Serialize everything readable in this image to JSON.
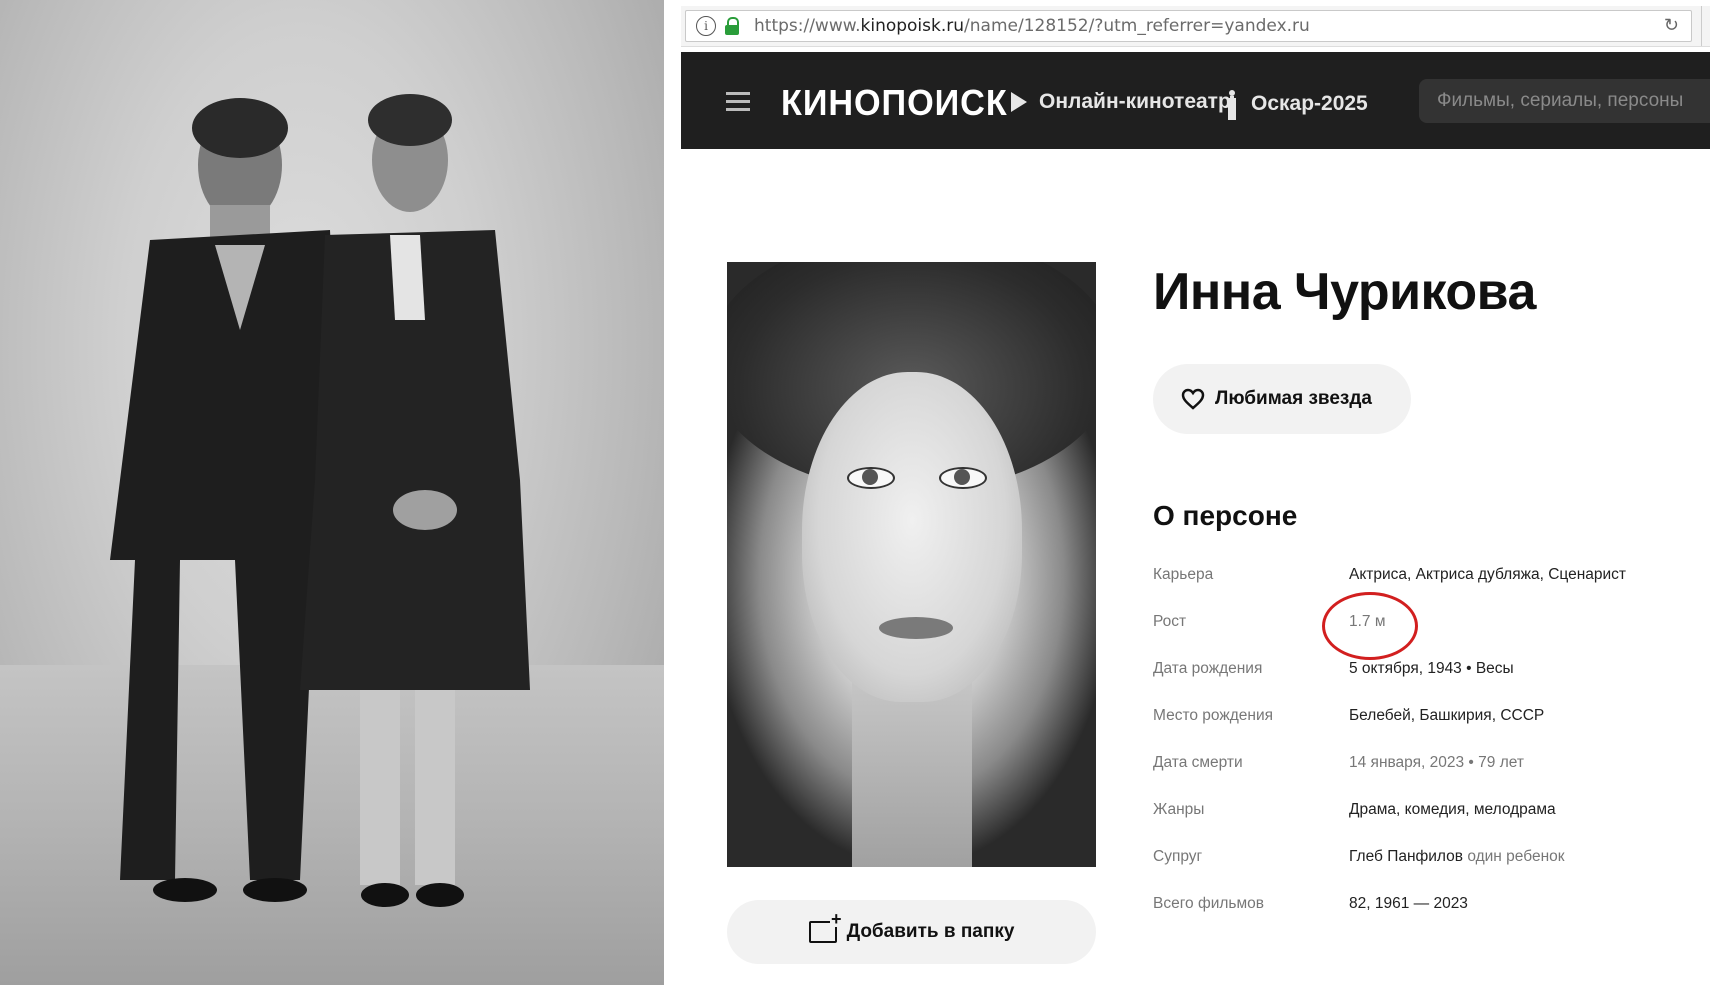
{
  "browser": {
    "url_prefix": "https://www.",
    "url_domain": "kinopoisk.ru",
    "url_rest": "/name/128152/?utm_referrer=yandex.ru"
  },
  "header": {
    "logo": "КИНОПОИСК",
    "nav_online": "Онлайн-кинотеатр",
    "nav_oscar": "Оскар-2025",
    "search_placeholder": "Фильмы, сериалы, персоны"
  },
  "person": {
    "name": "Инна Чурикова",
    "favorite_label": "Любимая звезда",
    "add_folder_label": "Добавить в папку",
    "about_title": "О персоне",
    "facts": [
      {
        "key": "Карьера",
        "value": "Актриса, Актриса дубляжа, Сценарист"
      },
      {
        "key": "Рост",
        "value": "1.7 м"
      },
      {
        "key": "Дата рождения",
        "value": "5 октября, 1943 • Весы"
      },
      {
        "key": "Место рождения",
        "value": "Белебей, Башкирия, СССР"
      },
      {
        "key": "Дата смерти",
        "value": "14 января, 2023 • 79 лет"
      },
      {
        "key": "Жанры",
        "value": "Драма, комедия, мелодрама"
      },
      {
        "key": "Супруг",
        "value": "Глеб Панфилов",
        "extra": "один ребенок"
      },
      {
        "key": "Всего фильмов",
        "value": "82, 1961 — 2023"
      }
    ]
  },
  "colors": {
    "header_bg": "#1f1f1f",
    "highlight_circle": "#d21f1f",
    "button_bg": "#f2f2f2"
  }
}
